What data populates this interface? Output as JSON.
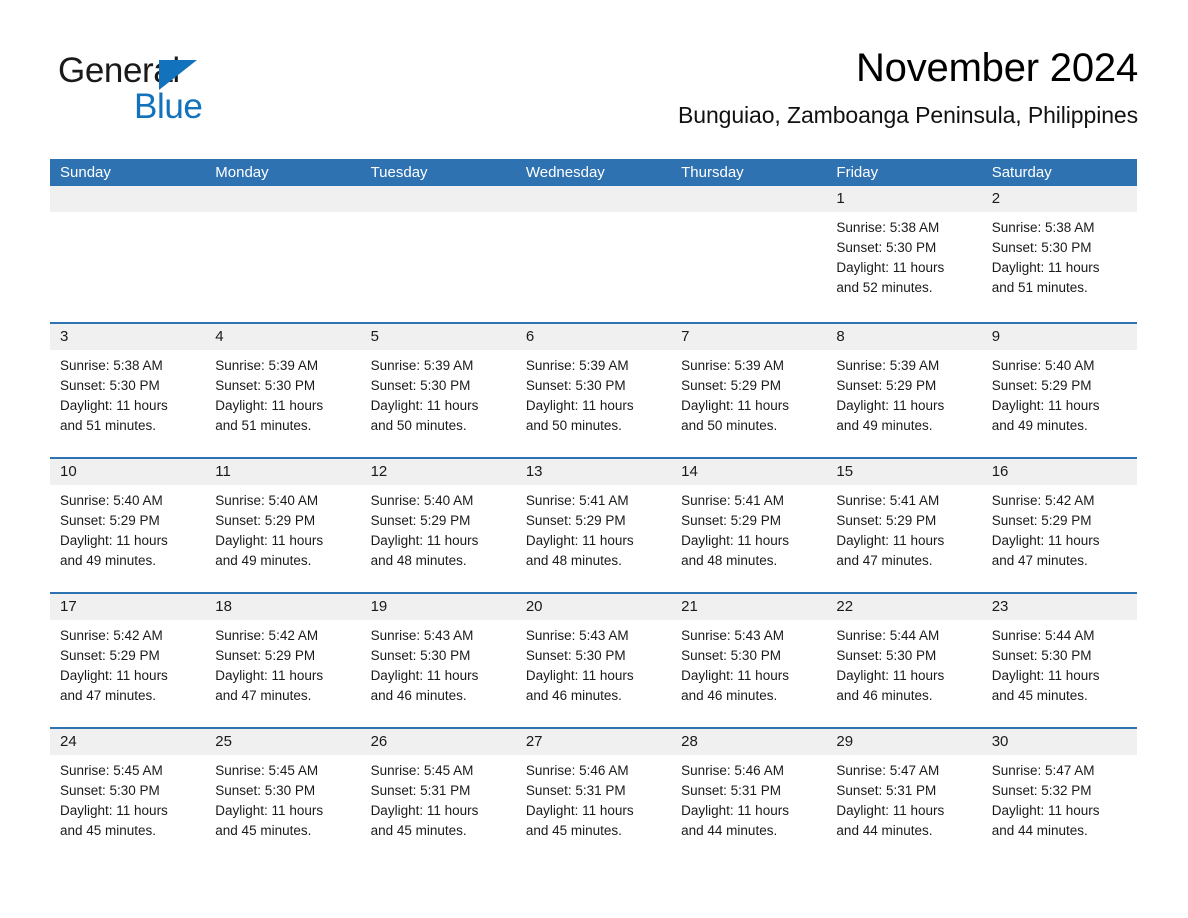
{
  "logo": {
    "word_primary": "General",
    "word_secondary": "Blue",
    "triangle_icon": "triangle-icon",
    "primary_color": "#1a1a1a",
    "accent_color": "#1272bc"
  },
  "header": {
    "title": "November 2024",
    "subtitle": "Bunguiao, Zamboanga Peninsula, Philippines"
  },
  "theme": {
    "header_blue": "#2e72b2",
    "day_band_gray": "#f0f0f0",
    "text_color": "#1a1a1a",
    "page_background": "#ffffff"
  },
  "calendar": {
    "month": "November",
    "year": "2024",
    "weekday_headers": [
      "Sunday",
      "Monday",
      "Tuesday",
      "Wednesday",
      "Thursday",
      "Friday",
      "Saturday"
    ],
    "weeks": [
      [
        {
          "day": "",
          "lines": []
        },
        {
          "day": "",
          "lines": []
        },
        {
          "day": "",
          "lines": []
        },
        {
          "day": "",
          "lines": []
        },
        {
          "day": "",
          "lines": []
        },
        {
          "day": "1",
          "lines": [
            "Sunrise: 5:38 AM",
            "Sunset: 5:30 PM",
            "Daylight: 11 hours",
            "and 52 minutes."
          ]
        },
        {
          "day": "2",
          "lines": [
            "Sunrise: 5:38 AM",
            "Sunset: 5:30 PM",
            "Daylight: 11 hours",
            "and 51 minutes."
          ]
        }
      ],
      [
        {
          "day": "3",
          "lines": [
            "Sunrise: 5:38 AM",
            "Sunset: 5:30 PM",
            "Daylight: 11 hours",
            "and 51 minutes."
          ]
        },
        {
          "day": "4",
          "lines": [
            "Sunrise: 5:39 AM",
            "Sunset: 5:30 PM",
            "Daylight: 11 hours",
            "and 51 minutes."
          ]
        },
        {
          "day": "5",
          "lines": [
            "Sunrise: 5:39 AM",
            "Sunset: 5:30 PM",
            "Daylight: 11 hours",
            "and 50 minutes."
          ]
        },
        {
          "day": "6",
          "lines": [
            "Sunrise: 5:39 AM",
            "Sunset: 5:30 PM",
            "Daylight: 11 hours",
            "and 50 minutes."
          ]
        },
        {
          "day": "7",
          "lines": [
            "Sunrise: 5:39 AM",
            "Sunset: 5:29 PM",
            "Daylight: 11 hours",
            "and 50 minutes."
          ]
        },
        {
          "day": "8",
          "lines": [
            "Sunrise: 5:39 AM",
            "Sunset: 5:29 PM",
            "Daylight: 11 hours",
            "and 49 minutes."
          ]
        },
        {
          "day": "9",
          "lines": [
            "Sunrise: 5:40 AM",
            "Sunset: 5:29 PM",
            "Daylight: 11 hours",
            "and 49 minutes."
          ]
        }
      ],
      [
        {
          "day": "10",
          "lines": [
            "Sunrise: 5:40 AM",
            "Sunset: 5:29 PM",
            "Daylight: 11 hours",
            "and 49 minutes."
          ]
        },
        {
          "day": "11",
          "lines": [
            "Sunrise: 5:40 AM",
            "Sunset: 5:29 PM",
            "Daylight: 11 hours",
            "and 49 minutes."
          ]
        },
        {
          "day": "12",
          "lines": [
            "Sunrise: 5:40 AM",
            "Sunset: 5:29 PM",
            "Daylight: 11 hours",
            "and 48 minutes."
          ]
        },
        {
          "day": "13",
          "lines": [
            "Sunrise: 5:41 AM",
            "Sunset: 5:29 PM",
            "Daylight: 11 hours",
            "and 48 minutes."
          ]
        },
        {
          "day": "14",
          "lines": [
            "Sunrise: 5:41 AM",
            "Sunset: 5:29 PM",
            "Daylight: 11 hours",
            "and 48 minutes."
          ]
        },
        {
          "day": "15",
          "lines": [
            "Sunrise: 5:41 AM",
            "Sunset: 5:29 PM",
            "Daylight: 11 hours",
            "and 47 minutes."
          ]
        },
        {
          "day": "16",
          "lines": [
            "Sunrise: 5:42 AM",
            "Sunset: 5:29 PM",
            "Daylight: 11 hours",
            "and 47 minutes."
          ]
        }
      ],
      [
        {
          "day": "17",
          "lines": [
            "Sunrise: 5:42 AM",
            "Sunset: 5:29 PM",
            "Daylight: 11 hours",
            "and 47 minutes."
          ]
        },
        {
          "day": "18",
          "lines": [
            "Sunrise: 5:42 AM",
            "Sunset: 5:29 PM",
            "Daylight: 11 hours",
            "and 47 minutes."
          ]
        },
        {
          "day": "19",
          "lines": [
            "Sunrise: 5:43 AM",
            "Sunset: 5:30 PM",
            "Daylight: 11 hours",
            "and 46 minutes."
          ]
        },
        {
          "day": "20",
          "lines": [
            "Sunrise: 5:43 AM",
            "Sunset: 5:30 PM",
            "Daylight: 11 hours",
            "and 46 minutes."
          ]
        },
        {
          "day": "21",
          "lines": [
            "Sunrise: 5:43 AM",
            "Sunset: 5:30 PM",
            "Daylight: 11 hours",
            "and 46 minutes."
          ]
        },
        {
          "day": "22",
          "lines": [
            "Sunrise: 5:44 AM",
            "Sunset: 5:30 PM",
            "Daylight: 11 hours",
            "and 46 minutes."
          ]
        },
        {
          "day": "23",
          "lines": [
            "Sunrise: 5:44 AM",
            "Sunset: 5:30 PM",
            "Daylight: 11 hours",
            "and 45 minutes."
          ]
        }
      ],
      [
        {
          "day": "24",
          "lines": [
            "Sunrise: 5:45 AM",
            "Sunset: 5:30 PM",
            "Daylight: 11 hours",
            "and 45 minutes."
          ]
        },
        {
          "day": "25",
          "lines": [
            "Sunrise: 5:45 AM",
            "Sunset: 5:30 PM",
            "Daylight: 11 hours",
            "and 45 minutes."
          ]
        },
        {
          "day": "26",
          "lines": [
            "Sunrise: 5:45 AM",
            "Sunset: 5:31 PM",
            "Daylight: 11 hours",
            "and 45 minutes."
          ]
        },
        {
          "day": "27",
          "lines": [
            "Sunrise: 5:46 AM",
            "Sunset: 5:31 PM",
            "Daylight: 11 hours",
            "and 45 minutes."
          ]
        },
        {
          "day": "28",
          "lines": [
            "Sunrise: 5:46 AM",
            "Sunset: 5:31 PM",
            "Daylight: 11 hours",
            "and 44 minutes."
          ]
        },
        {
          "day": "29",
          "lines": [
            "Sunrise: 5:47 AM",
            "Sunset: 5:31 PM",
            "Daylight: 11 hours",
            "and 44 minutes."
          ]
        },
        {
          "day": "30",
          "lines": [
            "Sunrise: 5:47 AM",
            "Sunset: 5:32 PM",
            "Daylight: 11 hours",
            "and 44 minutes."
          ]
        }
      ]
    ]
  }
}
